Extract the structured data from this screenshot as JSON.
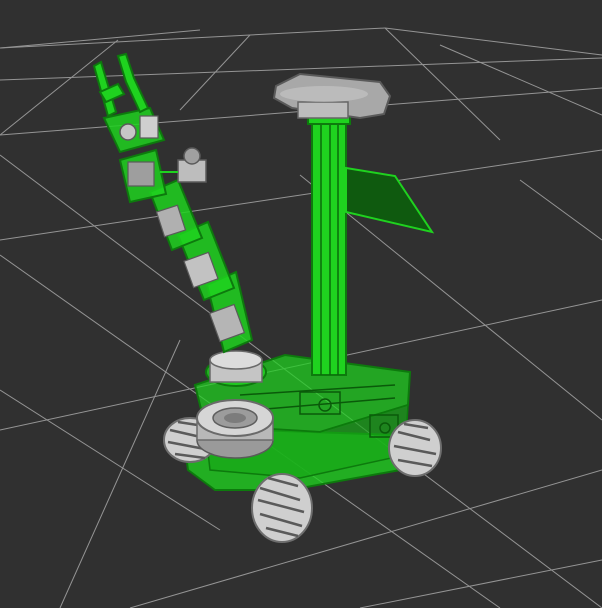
{
  "viewport": {
    "background": "#303030",
    "grid_color": "#a6a6a6",
    "highlight_color": "#1fd21f",
    "highlight_dark": "#0d7a0d",
    "metal_color": "#c8c8c8",
    "metal_dark": "#7c7c7c"
  },
  "scene": {
    "robot": "mobile-manipulator",
    "parts": [
      "mecanum-wheels",
      "base-plate",
      "upper-plate",
      "turntable",
      "vertical-column",
      "depth-camera",
      "display-panel",
      "arm-links",
      "wrist-camera",
      "gripper"
    ]
  }
}
